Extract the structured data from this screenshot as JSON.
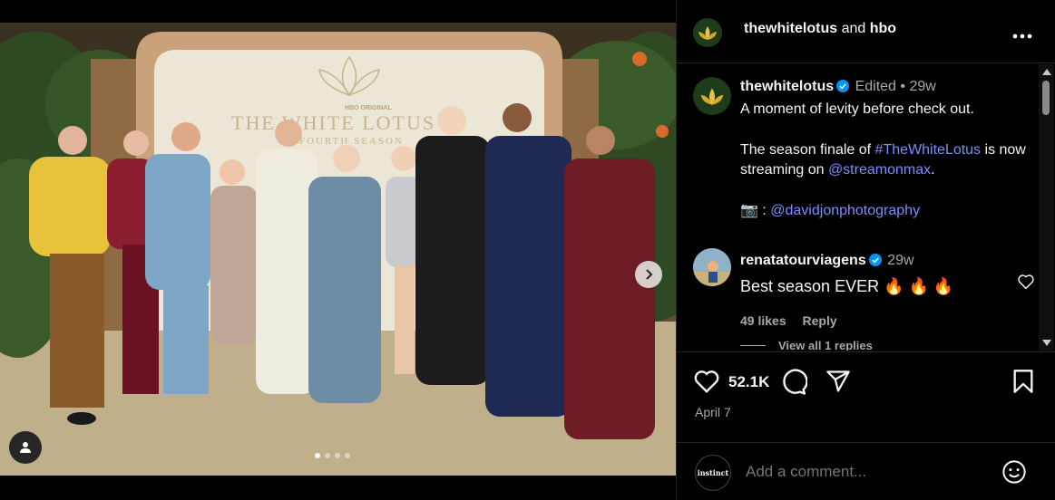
{
  "post": {
    "authors": {
      "primary": "thewhitelotus",
      "joiner": "and",
      "secondary": "hbo"
    },
    "photo": {
      "backdrop_logo_small": "HBO ORIGINAL",
      "backdrop_logo_title": "THE WHITE LOTUS",
      "backdrop_logo_sub": "FOURTH SEASON",
      "carousel_slides": 4,
      "carousel_active_index": 0
    },
    "caption": {
      "username": "thewhitelotus",
      "edited": "Edited",
      "separator": "•",
      "time": "29w",
      "line1": "A moment of levity before check out.",
      "line2_prefix": "The season finale of ",
      "line2_hashtag": "#TheWhiteLotus",
      "line2_mid": " is now streaming on ",
      "line2_mention": "@streamonmax",
      "line2_suffix": ".",
      "line3_prefix": "📷 : ",
      "line3_mention": "@davidjonphotography"
    },
    "comments": [
      {
        "username": "renatatourviagens",
        "time": "29w",
        "text": "Best season EVER 🔥 🔥 🔥",
        "likes": "49 likes",
        "reply": "Reply",
        "view_replies": "View all 1 replies"
      }
    ],
    "likes_count": "52.1K",
    "date": "April 7",
    "add_comment_placeholder": "Add a comment...",
    "commenter_avatar_text": "instinct"
  },
  "colors": {
    "background": "#000000",
    "text": "#f5f5f5",
    "muted": "#a8a8a8",
    "link": "#7b8dff",
    "verified": "#0095f6",
    "divider": "#262626"
  },
  "icons": [
    "more-options-icon",
    "verified-badge-icon",
    "heart-icon",
    "comment-icon",
    "share-icon",
    "save-icon",
    "emoji-icon",
    "tag-people-icon",
    "carousel-next-icon"
  ]
}
